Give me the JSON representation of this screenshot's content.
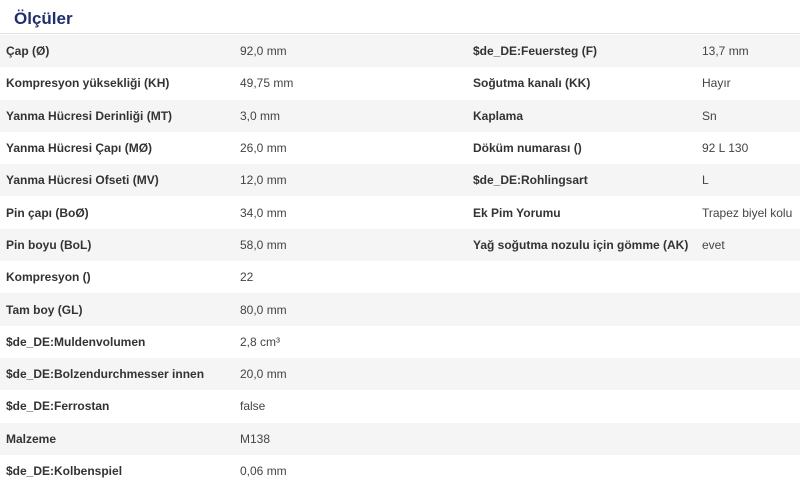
{
  "section": {
    "title": "Ölçüler"
  },
  "left_rows": [
    {
      "label": "Çap (Ø)",
      "value": "92,0 mm"
    },
    {
      "label": "Kompresyon yüksekliği (KH)",
      "value": "49,75 mm"
    },
    {
      "label": "Yanma Hücresi Derinliği (MT)",
      "value": "3,0 mm"
    },
    {
      "label": "Yanma Hücresi Çapı (MØ)",
      "value": "26,0 mm"
    },
    {
      "label": "Yanma Hücresi Ofseti (MV)",
      "value": "12,0 mm"
    },
    {
      "label": "Pin çapı (BoØ)",
      "value": "34,0 mm"
    },
    {
      "label": "Pin boyu (BoL)",
      "value": "58,0 mm"
    },
    {
      "label": "Kompresyon ()",
      "value": "22"
    },
    {
      "label": "Tam boy (GL)",
      "value": "80,0 mm"
    },
    {
      "label": "$de_DE:Muldenvolumen",
      "value": "2,8 cm³"
    },
    {
      "label": "$de_DE:Bolzendurchmesser innen",
      "value": "20,0 mm"
    },
    {
      "label": "$de_DE:Ferrostan",
      "value": "false"
    },
    {
      "label": "Malzeme",
      "value": "M138"
    },
    {
      "label": "$de_DE:Kolbenspiel",
      "value": "0,06 mm"
    }
  ],
  "right_rows": [
    {
      "label": "$de_DE:Feuersteg (F)",
      "value": "13,7 mm"
    },
    {
      "label": "Soğutma kanalı (KK)",
      "value": "Hayır"
    },
    {
      "label": "Kaplama",
      "value": "Sn"
    },
    {
      "label": "Döküm numarası ()",
      "value": "92 L 130"
    },
    {
      "label": "$de_DE:Rohlingsart",
      "value": "L"
    },
    {
      "label": "Ek Pim Yorumu",
      "value": "Trapez biyel kolu"
    },
    {
      "label": "Yağ soğutma nozulu için gömme (AK)",
      "value": "evet"
    },
    {
      "label": "",
      "value": ""
    },
    {
      "label": "",
      "value": ""
    },
    {
      "label": "",
      "value": ""
    },
    {
      "label": "",
      "value": ""
    },
    {
      "label": "",
      "value": ""
    },
    {
      "label": "",
      "value": ""
    },
    {
      "label": "",
      "value": ""
    }
  ]
}
